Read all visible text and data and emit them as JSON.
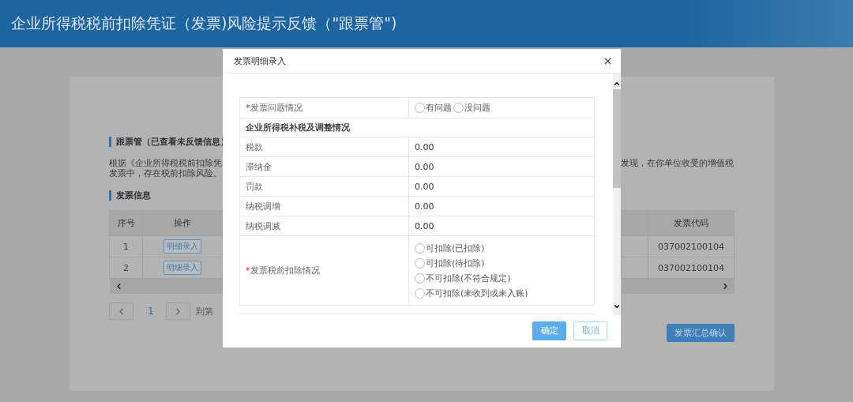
{
  "header": {
    "title": "企业所得税税前扣除凭证（发票)风险提示反馈（\"跟票管\")"
  },
  "background": {
    "section_title": "跟票管（已查看未反馈信息）",
    "paragraph_left": [
      "根据《企业所得税税前扣除凭",
      "发票中，存在税前扣除风险。"
    ],
    "paragraph_right": "发现，在你单位收受的增值税",
    "invoice_title": "发票信息",
    "table": {
      "columns_left": [
        "序号",
        "操作"
      ],
      "columns_right": [
        "发票代码"
      ],
      "rows": [
        {
          "index": "1",
          "action": "明细录入",
          "invoice_code": "037002100104"
        },
        {
          "index": "2",
          "action": "明细录入",
          "invoice_code": "037002100104"
        }
      ]
    },
    "pagination": {
      "current_page": "1",
      "goto_label": "到第"
    },
    "summary_button": "发票汇总确认"
  },
  "modal": {
    "title": "发票明细录入",
    "rows": [
      {
        "kind": "radio",
        "required_mark": "*",
        "label": "发票问题情况",
        "options": [
          {
            "label": "有问题",
            "selected": false
          },
          {
            "label": "没问题",
            "selected": false
          }
        ]
      },
      {
        "kind": "section",
        "label": "企业所得税补税及调整情况"
      },
      {
        "kind": "value",
        "label": "税款",
        "value": "0.00"
      },
      {
        "kind": "value",
        "label": "滞纳金",
        "value": "0.00"
      },
      {
        "kind": "value",
        "label": "罚款",
        "value": "0.00"
      },
      {
        "kind": "value",
        "label": "纳税调增",
        "value": "0.00"
      },
      {
        "kind": "value",
        "label": "纳税调减",
        "value": "0.00"
      },
      {
        "kind": "radio_list",
        "required_mark": "*",
        "label": "发票税前扣除情况",
        "options": [
          {
            "label": "可扣除(已扣除)",
            "selected": false
          },
          {
            "label": "可扣除(待扣除)",
            "selected": false
          },
          {
            "label": "不可扣除(不符合规定)",
            "selected": false
          },
          {
            "label": "不可扣除(未收到或未入账)",
            "selected": false
          }
        ]
      }
    ],
    "buttons": [
      {
        "label": "确定",
        "primary": true
      },
      {
        "label": "取消",
        "primary": false
      }
    ]
  }
}
